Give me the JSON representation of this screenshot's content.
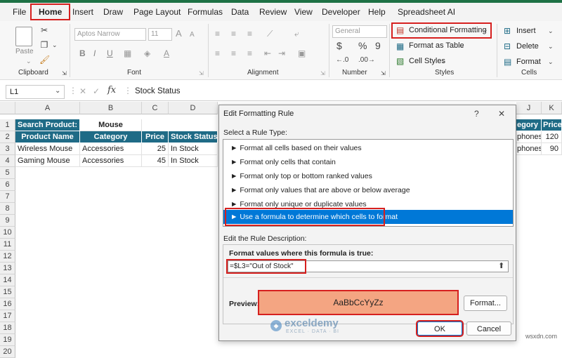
{
  "menu": {
    "items": [
      "File",
      "Home",
      "Insert",
      "Draw",
      "Page Layout",
      "Formulas",
      "Data",
      "Review",
      "View",
      "Developer",
      "Help",
      "Spreadsheet AI"
    ]
  },
  "ribbon": {
    "clipboard": {
      "paste_label": "Paste",
      "group_label": "Clipboard"
    },
    "font": {
      "font_name": "Aptos Narrow",
      "font_size": "11",
      "group_label": "Font",
      "bold": "B",
      "italic": "I",
      "underline": "U",
      "grow": "A",
      "shrink": "A"
    },
    "alignment": {
      "group_label": "Alignment"
    },
    "number": {
      "format": "General",
      "currency": "$",
      "percent": "%",
      "comma": "9",
      "group_label": "Number"
    },
    "styles": {
      "conditional_formatting": "Conditional Formatting",
      "format_as_table": "Format as Table",
      "cell_styles": "Cell Styles",
      "group_label": "Styles"
    },
    "cells": {
      "insert": "Insert",
      "delete": "Delete",
      "format": "Format",
      "group_label": "Cells"
    }
  },
  "formula_bar": {
    "name_box": "L1",
    "cancel": "✕",
    "enter": "✓",
    "fx": "fx",
    "content": "Stock Status"
  },
  "grid": {
    "columns": [
      "A",
      "B",
      "C",
      "D",
      "J",
      "K"
    ],
    "rows": [
      "1",
      "2",
      "3",
      "4",
      "5",
      "6",
      "7",
      "8",
      "9",
      "10",
      "11",
      "12",
      "13",
      "14",
      "15",
      "16",
      "17",
      "18",
      "19",
      "20"
    ],
    "search_label": "Search Product:",
    "search_value": "Mouse",
    "headers": [
      "Product Name",
      "Category",
      "Price",
      "Stock Status"
    ],
    "data_rows": [
      [
        "Wireless Mouse",
        "Accessories",
        "25",
        "In Stock"
      ],
      [
        "Gaming Mouse",
        "Accessories",
        "45",
        "In Stock"
      ]
    ],
    "right_headers": [
      "egory",
      "Price"
    ],
    "right_rows": [
      [
        "phones",
        "120"
      ],
      [
        "phones",
        "90"
      ]
    ]
  },
  "dialog": {
    "title": "Edit Formatting Rule",
    "help": "?",
    "close": "✕",
    "select_label": "Select a Rule Type:",
    "rule_types": [
      "Format all cells based on their values",
      "Format only cells that contain",
      "Format only top or bottom ranked values",
      "Format only values that are above or below average",
      "Format only unique or duplicate values",
      "Use a formula to determine which cells to format"
    ],
    "selected_index": 5,
    "edit_label": "Edit the Rule Description:",
    "formula_label": "Format values where this formula is true:",
    "formula": "=$L3=\"Out of Stock\"",
    "preview_label": "Preview:",
    "preview_text": "AaBbCcYyZz",
    "preview_color": "#f4a582",
    "format_button": "Format...",
    "ok": "OK",
    "cancel": "Cancel"
  },
  "watermark": {
    "name": "exceldemy",
    "tagline": "EXCEL · DATA · BI"
  },
  "site": "wsxdn.com",
  "colors": {
    "accent": "#1e7145",
    "table_header": "#1f6b86",
    "selection": "#0078d7",
    "highlight": "#d6201f"
  }
}
